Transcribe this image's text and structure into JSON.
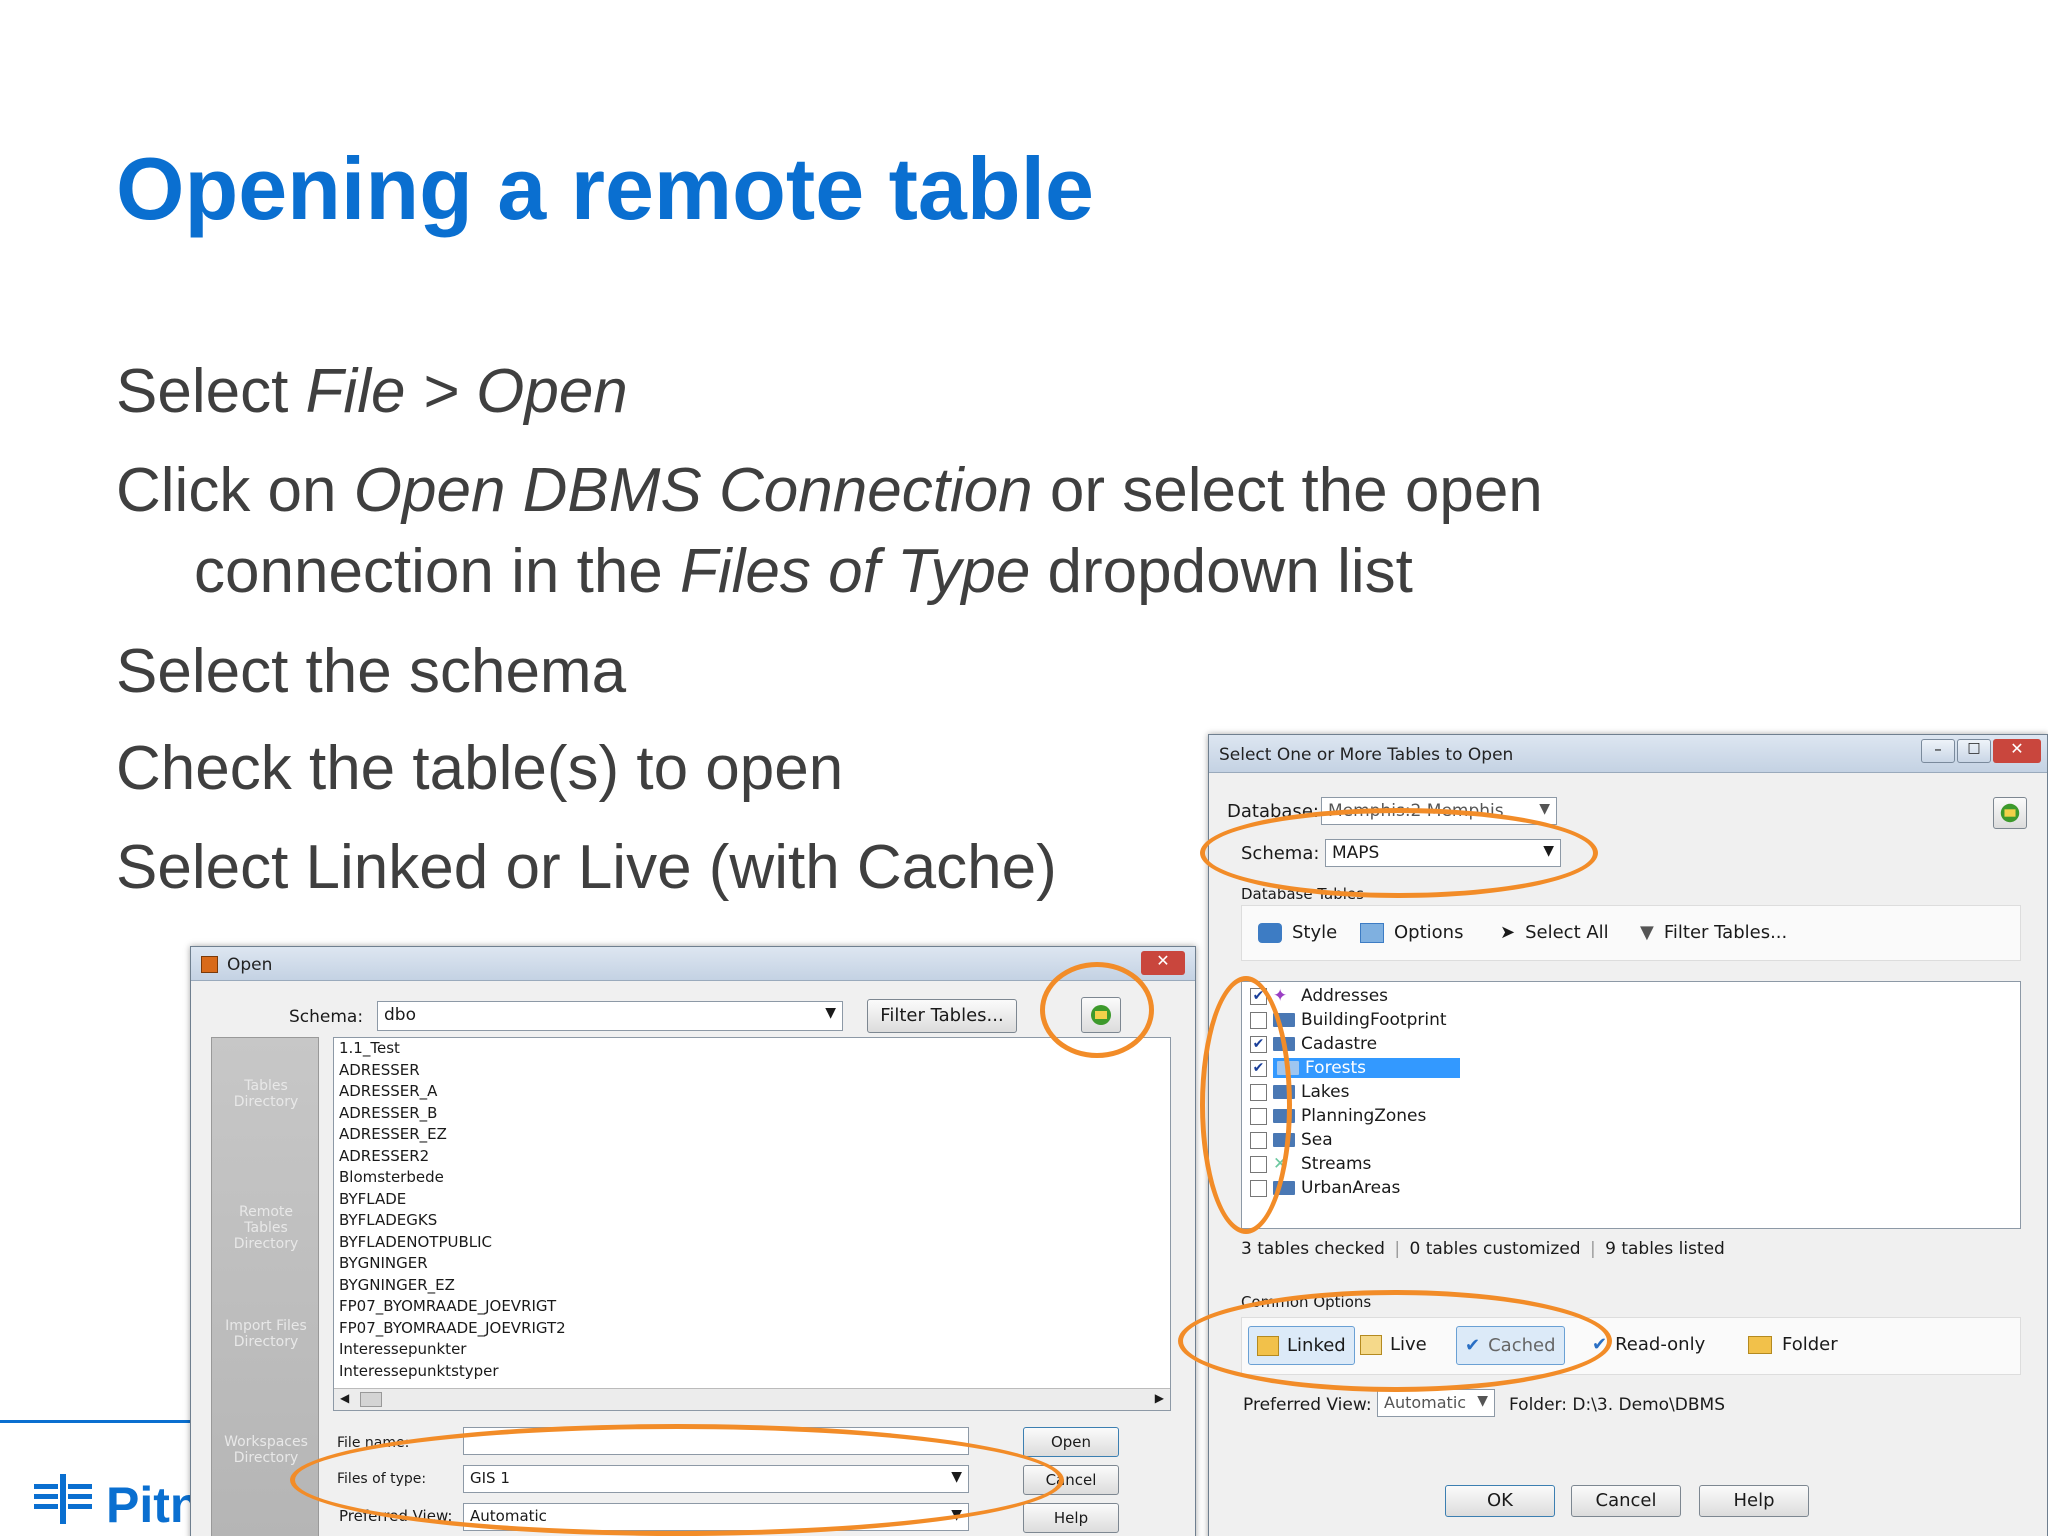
{
  "slide": {
    "title": "Opening a remote table",
    "bullets": {
      "b1_a": "Select ",
      "b1_b": "File > Open",
      "b2_a": "Click on ",
      "b2_b": "Open DBMS Connection",
      "b2_c": " or select the open",
      "b2_d": "connection in the ",
      "b2_e": "Files of Type",
      "b2_f": " dropdown list",
      "b3": "Select the schema",
      "b4": "Check the table(s) to open",
      "b5": "Select Linked or Live (with Cache)"
    },
    "logo_text": "Pitn"
  },
  "open_dialog": {
    "title": "Open",
    "schema_label": "Schema:",
    "schema_value": "dbo",
    "filter_button": "Filter Tables...",
    "places": [
      "Tables Directory",
      "Remote Tables Directory",
      "Import Files Directory",
      "Workspaces Directory"
    ],
    "tables": [
      "1.1_Test",
      "ADRESSER",
      "ADRESSER_A",
      "ADRESSER_B",
      "ADRESSER_EZ",
      "ADRESSER2",
      "Blomsterbede",
      "BYFLADE",
      "BYFLADEGKS",
      "BYFLADENOTPUBLIC",
      "BYGNINGER",
      "BYGNINGER_EZ",
      "FP07_BYOMRAADE_JOEVRIGT",
      "FP07_BYOMRAADE_JOEVRIGT2",
      "Interessepunkter",
      "Interessepunktstyper"
    ],
    "file_name_label": "File name:",
    "files_of_type_label": "Files of type:",
    "files_of_type_value": "GIS 1",
    "preferred_view_label": "Preferred View:",
    "preferred_view_value": "Automatic",
    "open_button": "Open",
    "cancel_button": "Cancel",
    "help_button": "Help"
  },
  "select_dialog": {
    "title": "Select One or More Tables to Open",
    "database_label": "Database:",
    "database_value": "Memphis:2 Memphis",
    "schema_label": "Schema:",
    "schema_value": "MAPS",
    "db_tables_label": "Database Tables",
    "toolbar": {
      "style": "Style",
      "options": "Options",
      "select_all": "Select All",
      "filter_tables": "Filter Tables..."
    },
    "tables": [
      {
        "name": "Addresses",
        "checked": true
      },
      {
        "name": "BuildingFootprint",
        "checked": false
      },
      {
        "name": "Cadastre",
        "checked": true
      },
      {
        "name": "Forests",
        "checked": true
      },
      {
        "name": "Lakes",
        "checked": false
      },
      {
        "name": "PlanningZones",
        "checked": false
      },
      {
        "name": "Sea",
        "checked": false
      },
      {
        "name": "Streams",
        "checked": false
      },
      {
        "name": "UrbanAreas",
        "checked": false
      }
    ],
    "status": {
      "checked": "3 tables checked",
      "customized": "0 tables customized",
      "listed": "9 tables listed"
    },
    "common_options_label": "Common Options",
    "options": {
      "linked": "Linked",
      "live": "Live",
      "cached": "Cached",
      "readonly": "Read-only",
      "folder": "Folder"
    },
    "preferred_view_label": "Preferred View:",
    "preferred_view_value": "Automatic",
    "folder_path": "Folder: D:\\3. Demo\\DBMS",
    "ok_button": "OK",
    "cancel_button": "Cancel",
    "help_button": "Help"
  },
  "colors": {
    "title_blue": "#0a6fd0",
    "highlight_orange": "#f28c28",
    "selection_blue": "#3399ff"
  }
}
